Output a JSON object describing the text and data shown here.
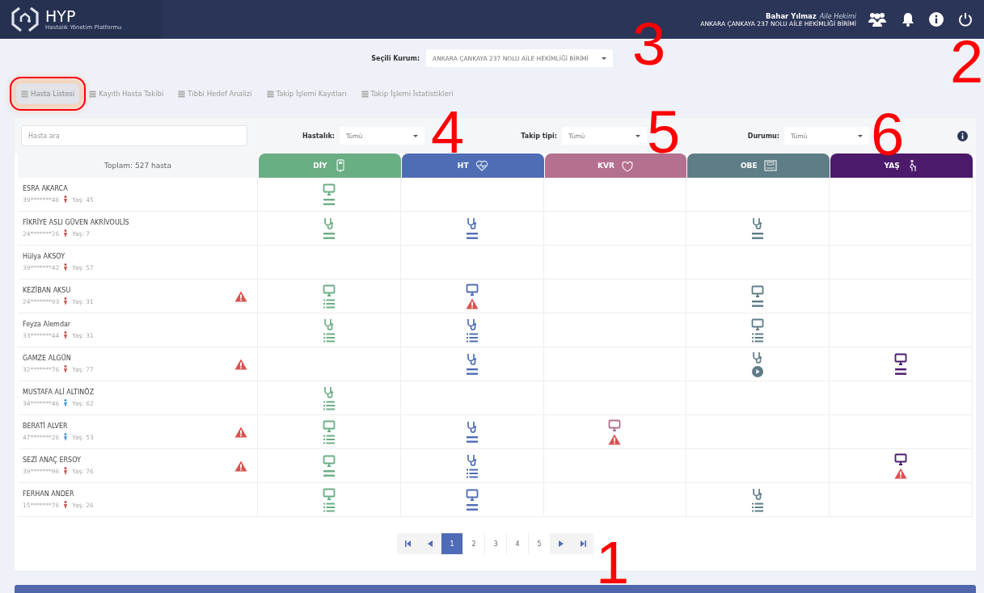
{
  "brand": {
    "name": "HYP",
    "subtitle": "Hastalık Yönetim Platformu"
  },
  "user": {
    "name": "Bahar Yılmaz",
    "role": "Aile Hekimi",
    "unit": "ANKARA ÇANKAYA 237 NOLU AİLE HEKİMLİĞİ BİRİMİ"
  },
  "institution": {
    "label": "Seçili Kurum:",
    "value": "ANKARA ÇANKAYA 237 NOLU AİLE HEKİMLİĞİ BİRİMİ"
  },
  "tabs": [
    {
      "label": "Hasta Listesi",
      "selected": true,
      "highlighted": true
    },
    {
      "label": "Kayıtlı Hasta Takibi",
      "selected": false,
      "highlighted": false
    },
    {
      "label": "Tıbbi Hedef Analizi",
      "selected": false,
      "highlighted": false
    },
    {
      "label": "Takip İşlemi Kayıtları",
      "selected": false,
      "highlighted": false
    },
    {
      "label": "Takip İşlemi İstatistikleri",
      "selected": false,
      "highlighted": false
    }
  ],
  "search": {
    "placeholder": "Hasta ara"
  },
  "filters": [
    {
      "label": "Hastalık:",
      "value": "Tümü"
    },
    {
      "label": "Takip tipi:",
      "value": "Tümü"
    },
    {
      "label": "Durumu:",
      "value": "Tümü"
    }
  ],
  "total": "Toplam: 527 hasta",
  "columns": [
    {
      "label": "DİY",
      "color": "#6aae84"
    },
    {
      "label": "HT",
      "color": "#4f6db5"
    },
    {
      "label": "KVR",
      "color": "#b4708f"
    },
    {
      "label": "OBE",
      "color": "#5f7d87"
    },
    {
      "label": "YAŞ",
      "color": "#4b1a6b"
    }
  ],
  "rows": [
    {
      "name": "ESRA AKARCA",
      "id": "39*******46",
      "male": false,
      "age": "Yaş: 45",
      "alert": false,
      "cells": [
        [
          {
            "kind": "monitor"
          },
          {
            "kind": "equals"
          }
        ],
        [],
        [],
        [],
        []
      ]
    },
    {
      "name": "FİKRİYE ASLI GÜVEN AKRİVOULİS",
      "id": "24*******26",
      "male": false,
      "age": "Yaş: 7",
      "alert": false,
      "cells": [
        [
          {
            "kind": "stethoscope"
          },
          {
            "kind": "equals"
          }
        ],
        [
          {
            "kind": "stethoscope"
          },
          {
            "kind": "equals"
          }
        ],
        [],
        [
          {
            "kind": "stethoscope"
          },
          {
            "kind": "equals"
          }
        ],
        []
      ]
    },
    {
      "name": "Hülya AKSOY",
      "id": "39*******42",
      "male": false,
      "age": "Yaş: 57",
      "alert": false,
      "cells": [
        [],
        [],
        [],
        [],
        []
      ]
    },
    {
      "name": "KEZİBAN AKSU",
      "id": "24*******93",
      "male": false,
      "age": "Yaş: 31",
      "alert": true,
      "cells": [
        [
          {
            "kind": "monitor"
          },
          {
            "kind": "list"
          }
        ],
        [
          {
            "kind": "monitor"
          },
          {
            "kind": "warning"
          }
        ],
        [],
        [
          {
            "kind": "monitor"
          },
          {
            "kind": "equals"
          }
        ],
        []
      ]
    },
    {
      "name": "Feyza Alemdar",
      "id": "33*******44",
      "male": false,
      "age": "Yaş: 31",
      "alert": false,
      "cells": [
        [
          {
            "kind": "stethoscope"
          },
          {
            "kind": "list"
          }
        ],
        [
          {
            "kind": "stethoscope"
          },
          {
            "kind": "list"
          }
        ],
        [],
        [
          {
            "kind": "monitor"
          },
          {
            "kind": "list"
          }
        ],
        []
      ]
    },
    {
      "name": "GAMZE ALGÜN",
      "id": "32*******76",
      "male": false,
      "age": "Yaş: 77",
      "alert": true,
      "cells": [
        [],
        [
          {
            "kind": "stethoscope"
          },
          {
            "kind": "equals"
          }
        ],
        [],
        [
          {
            "kind": "stethoscope"
          },
          {
            "kind": "play"
          }
        ],
        [
          {
            "kind": "monitor"
          },
          {
            "kind": "equals"
          }
        ]
      ]
    },
    {
      "name": "MUSTAFA ALİ ALTINÖZ",
      "id": "34*******46",
      "male": true,
      "age": "Yaş: 62",
      "alert": false,
      "cells": [
        [
          {
            "kind": "stethoscope"
          },
          {
            "kind": "list"
          }
        ],
        [],
        [],
        [],
        []
      ]
    },
    {
      "name": "BERATİ ALVER",
      "id": "47*******26",
      "male": true,
      "age": "Yaş: 53",
      "alert": true,
      "cells": [
        [
          {
            "kind": "monitor"
          },
          {
            "kind": "list"
          }
        ],
        [
          {
            "kind": "stethoscope"
          },
          {
            "kind": "equals"
          }
        ],
        [
          {
            "kind": "monitor"
          },
          {
            "kind": "warning"
          }
        ],
        [],
        []
      ]
    },
    {
      "name": "SEZİ ANAÇ ERSOY",
      "id": "39*******96",
      "male": false,
      "age": "Yaş: 76",
      "alert": true,
      "cells": [
        [
          {
            "kind": "monitor"
          },
          {
            "kind": "equals"
          }
        ],
        [
          {
            "kind": "stethoscope"
          },
          {
            "kind": "list"
          }
        ],
        [],
        [],
        [
          {
            "kind": "monitor"
          },
          {
            "kind": "warning"
          }
        ]
      ]
    },
    {
      "name": "FERHAN ANDER",
      "id": "15*******76",
      "male": false,
      "age": "Yaş: 26",
      "alert": false,
      "cells": [
        [
          {
            "kind": "monitor"
          },
          {
            "kind": "list"
          }
        ],
        [
          {
            "kind": "monitor"
          },
          {
            "kind": "equals"
          }
        ],
        [],
        [
          {
            "kind": "stethoscope"
          },
          {
            "kind": "list"
          }
        ],
        []
      ]
    }
  ],
  "pagination": [
    {
      "label": "1",
      "selected": true
    },
    {
      "label": "2",
      "selected": false
    },
    {
      "label": "3",
      "selected": false
    },
    {
      "label": "4",
      "selected": false
    },
    {
      "label": "5",
      "selected": false
    }
  ],
  "annotations": [
    {
      "label": "3"
    },
    {
      "label": "2"
    },
    {
      "label": "4"
    },
    {
      "label": "5"
    },
    {
      "label": "6"
    },
    {
      "label": "1"
    }
  ]
}
